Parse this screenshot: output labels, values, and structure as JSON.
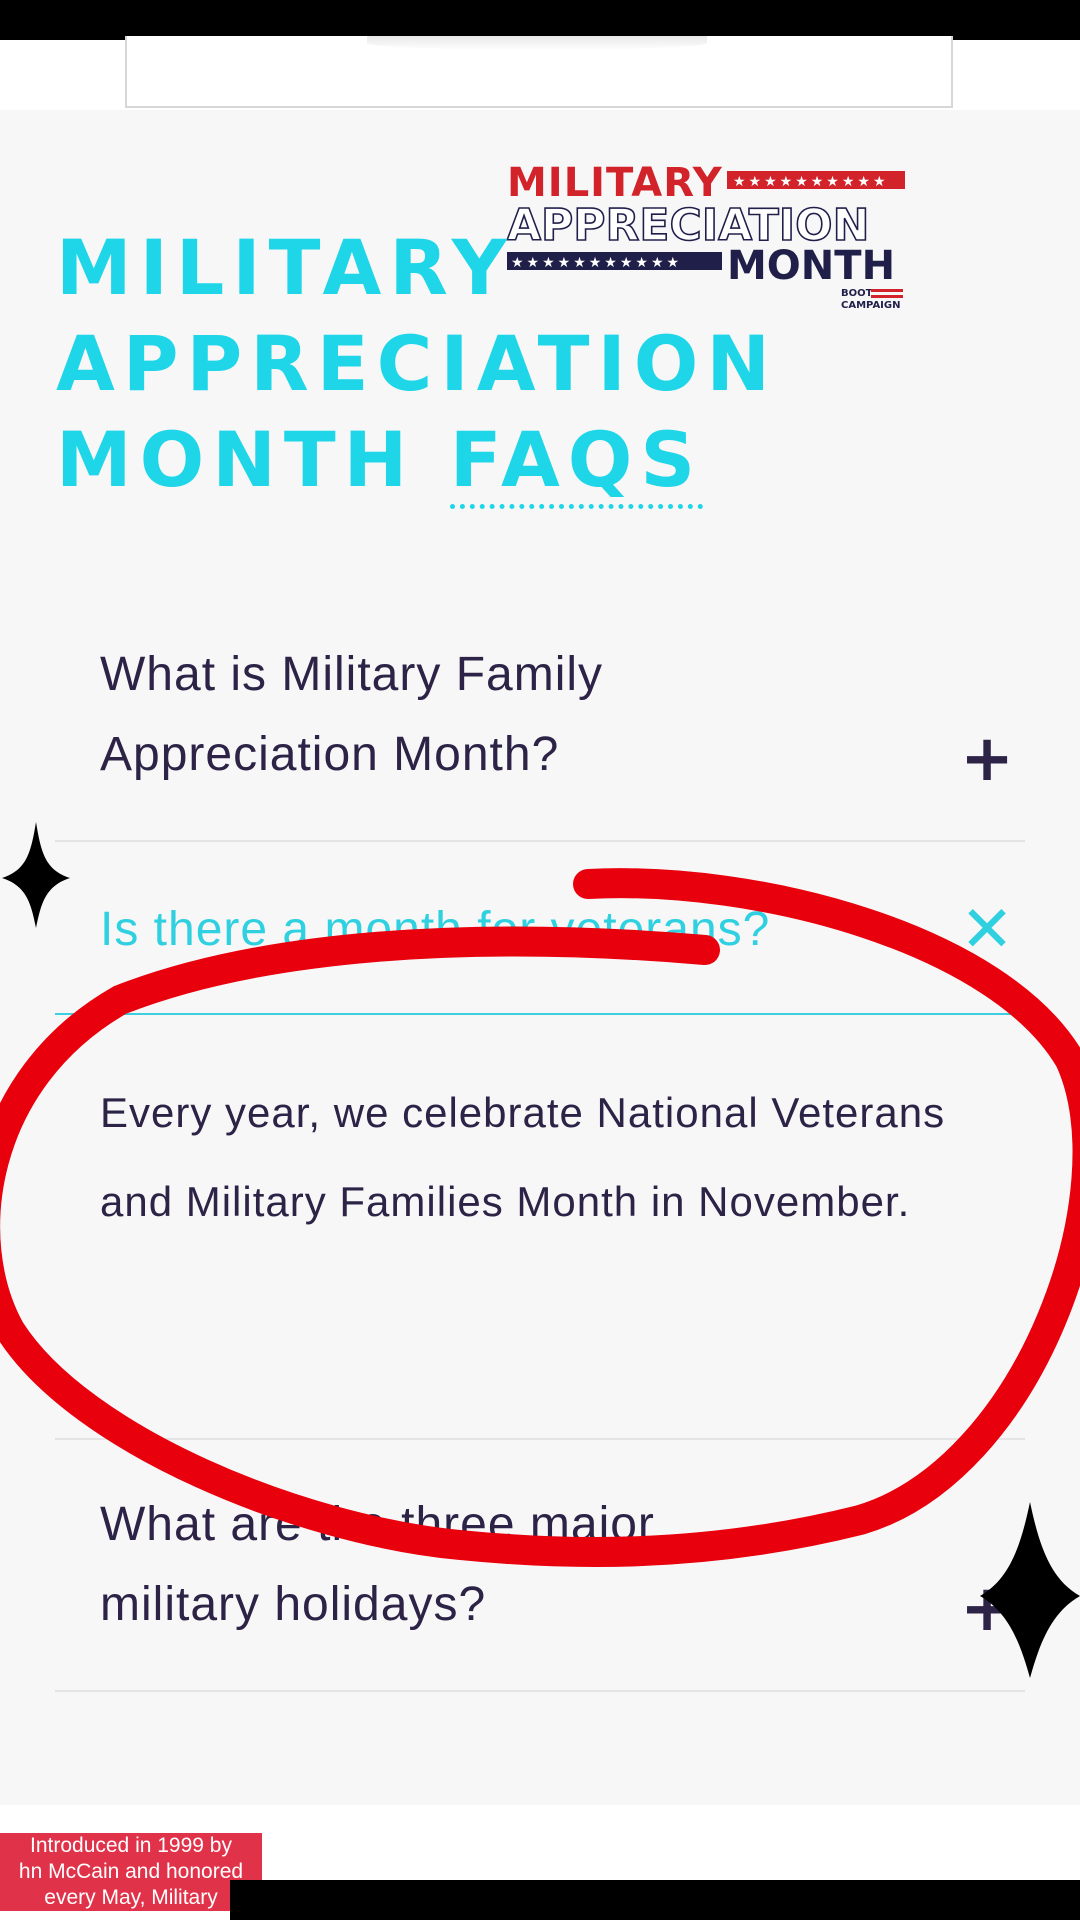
{
  "logo": {
    "line1": "MILITARY",
    "line2": "APPRECIATION",
    "line3": "MONTH",
    "sub1": "BOOT",
    "sub2": "CAMPAIGN"
  },
  "faq": {
    "title_line1": "MILITARY",
    "title_line2": "APPRECIATION",
    "title_line3_word": "MONTH",
    "title_line3_abbr": "FAQS",
    "items": [
      {
        "question_line1": "What is Military Family",
        "question_line2": "Appreciation Month?",
        "toggle": "+"
      },
      {
        "question": "Is there a month for veterans?",
        "toggle": "✕",
        "answer": "Every year, we celebrate National Veterans and Military Families Month in November."
      },
      {
        "question_line1": "What are the three major",
        "question_line2": "military holidays?",
        "toggle": "+"
      }
    ]
  },
  "caption": {
    "line1": "Introduced in 1999 by",
    "line2": "hn McCain and honored",
    "line3": "every May, Military"
  },
  "colors": {
    "accent": "#1fd6e8",
    "text": "#2d2346",
    "logo_red": "#d2232a",
    "logo_navy": "#1f1f4a",
    "annotation_red": "#e8000d"
  }
}
